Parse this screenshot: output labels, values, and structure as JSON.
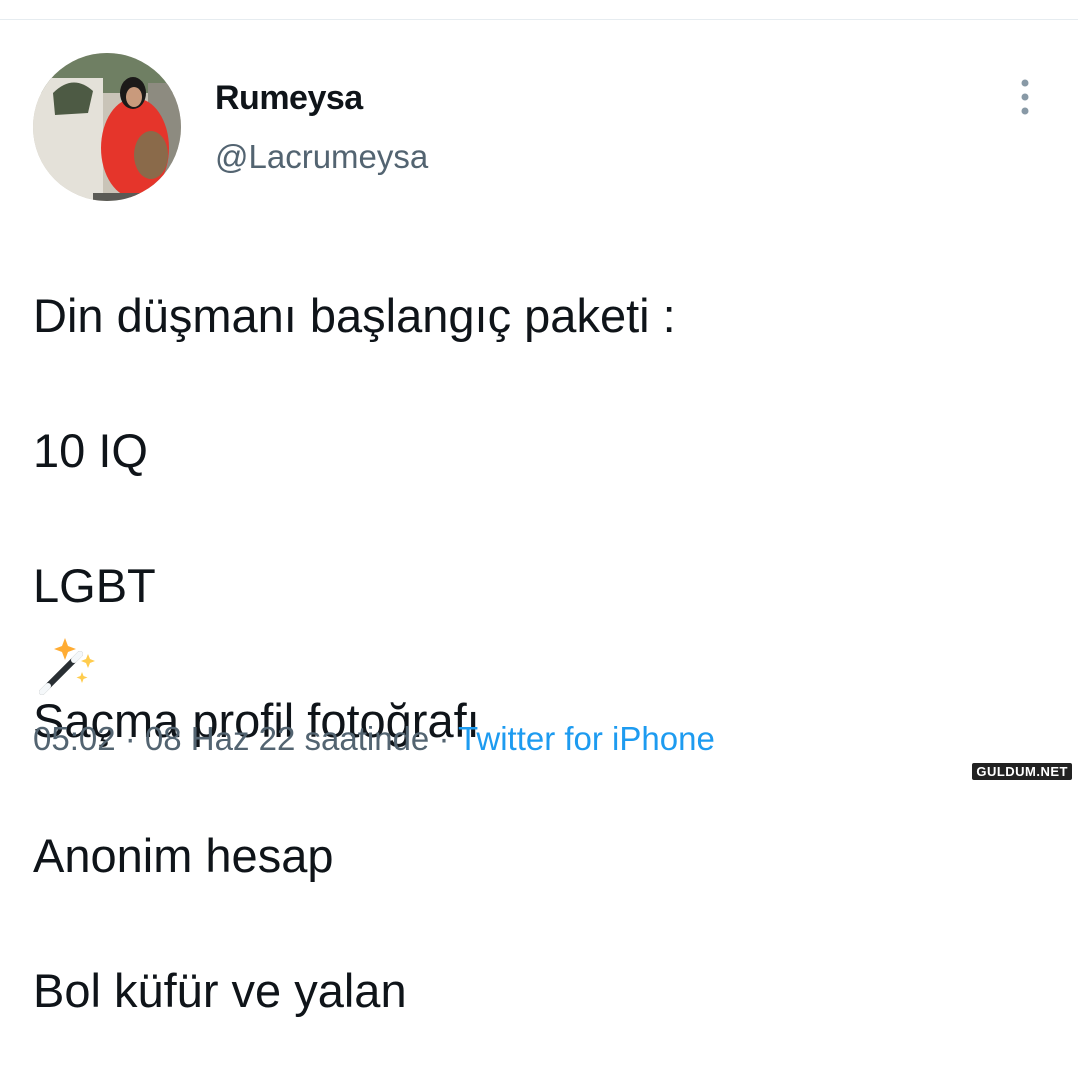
{
  "user": {
    "display_name": "Rumeysa",
    "handle": "@Lacrumeysa",
    "avatar_icon": "profile-photo"
  },
  "tweet": {
    "lines": [
      "Din düşmanı başlangıç paketi :",
      "10 IQ",
      "LGBT",
      "Saçma profil fotoğrafı",
      "Anonim hesap",
      "Bol küfür ve yalan"
    ],
    "emoji_icon": "magic-wand-sparkles"
  },
  "meta": {
    "time": "05:02",
    "separator1": " · ",
    "date": "08 Haz 22 saatinde",
    "separator2": " · ",
    "source": "Twitter for iPhone"
  },
  "colors": {
    "text": "#0f1419",
    "secondary": "#536471",
    "link": "#1d9bf0"
  },
  "watermark": "GULDUM.NET"
}
